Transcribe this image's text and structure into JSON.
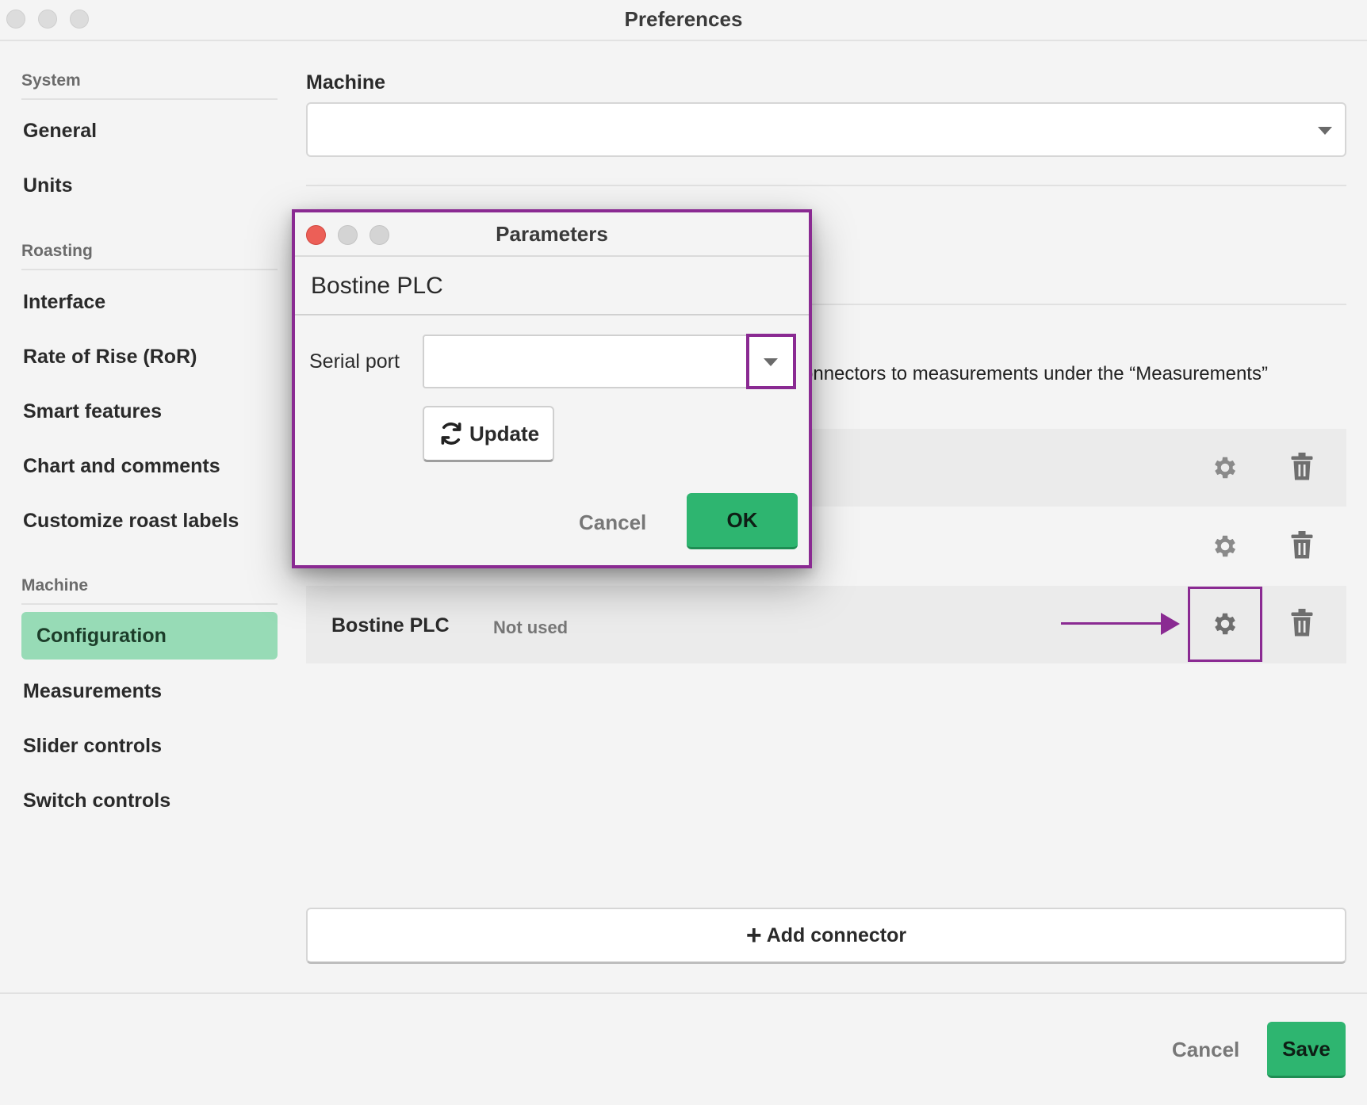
{
  "window": {
    "title": "Preferences"
  },
  "sidebar": {
    "sections": [
      {
        "title": "System",
        "items": [
          "General",
          "Units"
        ]
      },
      {
        "title": "Roasting",
        "items": [
          "Interface",
          "Rate of Rise (RoR)",
          "Smart features",
          "Chart and comments",
          "Customize roast labels"
        ]
      },
      {
        "title": "Machine",
        "items": [
          "Configuration",
          "Measurements",
          "Slider controls",
          "Switch controls"
        ]
      }
    ],
    "active_item": "Configuration"
  },
  "main": {
    "machine_label": "Machine",
    "machine_select_value": "",
    "help_text": "onnectors to measurements under the “Measurements”",
    "connectors": [
      {
        "name": "",
        "status": ""
      },
      {
        "name": "",
        "status": ""
      },
      {
        "name": "Bostine PLC",
        "status": "Not used"
      }
    ],
    "add_connector_label": "Add connector"
  },
  "footer": {
    "cancel_label": "Cancel",
    "save_label": "Save"
  },
  "dialog": {
    "title": "Parameters",
    "heading": "Bostine PLC",
    "serial_port_label": "Serial port",
    "serial_port_value": "",
    "update_label": "Update",
    "cancel_label": "Cancel",
    "ok_label": "OK"
  },
  "colors": {
    "accent_green": "#2eb570",
    "active_sidebar": "#97dbb6",
    "annotation_purple": "#8a2a92",
    "close_red": "#ec5f57"
  },
  "icons": {
    "settings": "gear-icon",
    "delete": "trash-icon",
    "refresh": "refresh-icon",
    "add": "plus-icon",
    "dropdown": "chevron-down-icon"
  }
}
